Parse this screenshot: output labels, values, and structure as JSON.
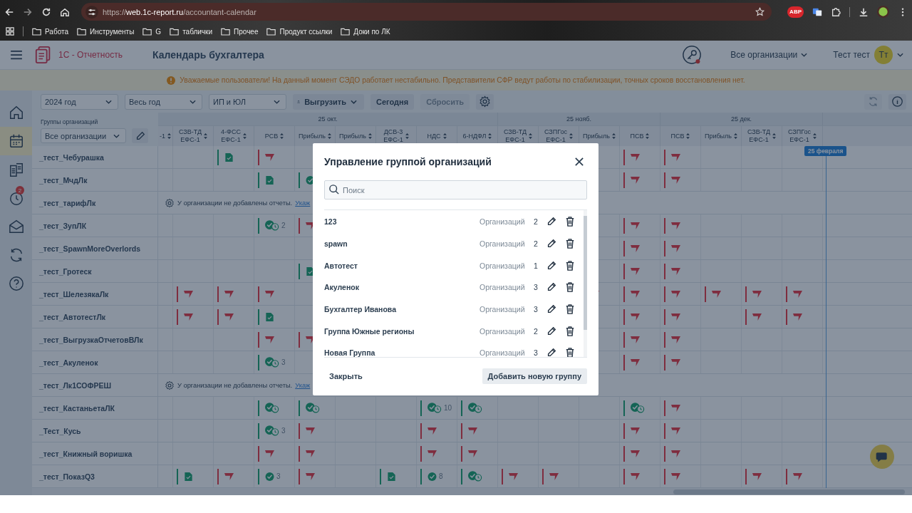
{
  "browser": {
    "url_scheme": "https://",
    "url_host": "web.1c-report.ru",
    "url_path": "/accountant-calendar",
    "extension_label": "ABP",
    "bookmarks": [
      "Работа",
      "Инструменты",
      "G",
      "таблички",
      "Прочее",
      "Продукт ссылки",
      "Доки по ЛК"
    ]
  },
  "header": {
    "app_name": "1С - Отчетность",
    "page_title": "Календарь бухгалтера",
    "key_alert": true,
    "org_select": "Все организации",
    "user_name": "Тест тест",
    "avatar": "Тт"
  },
  "banner": "Уважаемые пользователи! На данный момент СЭДО работает нестабильно. Представители СФР ведут работы по стабилизации, точных сроков восстановления нет.",
  "sidebar": [
    {
      "selected": false
    },
    {
      "selected": true
    },
    {
      "selected": false
    },
    {
      "selected": false,
      "badge": "2"
    },
    {
      "selected": false
    },
    {
      "selected": false
    },
    {
      "selected": false
    }
  ],
  "toolbar": {
    "year": "2024 год",
    "period": "Весь год",
    "entity": "ИП и ЮЛ",
    "export": "Выгрузить",
    "today": "Сегодня",
    "reset": {
      "label": "Сбросить",
      "disabled": true
    },
    "refresh_disabled": true
  },
  "groups_filter": {
    "label": "Группы организаций",
    "value": "Все организации"
  },
  "months": [
    {
      "label": "25 окт.",
      "columns": [
        {
          "lines": [
            "-1"
          ]
        },
        {
          "lines": [
            "СЗВ-ТД",
            "ЕФС-1"
          ]
        },
        {
          "lines": [
            "4-ФСС",
            "ЕФС-1"
          ]
        },
        {
          "lines": [
            "РСВ"
          ]
        },
        {
          "lines": [
            "Прибыль"
          ]
        },
        {
          "lines": [
            "Прибыль"
          ]
        },
        {
          "lines": [
            "ДСВ-3",
            "ЕФС-1"
          ]
        },
        {
          "lines": [
            "НДС"
          ]
        },
        {
          "lines": [
            "6-НДФЛ"
          ]
        }
      ]
    },
    {
      "label": "25 нояб.",
      "columns": [
        {
          "lines": [
            "СЗВ-ТД",
            "ЕФС-1"
          ]
        },
        {
          "lines": [
            "СЗПГос",
            "ЕФС-1"
          ]
        },
        {
          "lines": [
            "Прибыль"
          ]
        },
        {
          "lines": [
            "ПСВ"
          ]
        }
      ]
    },
    {
      "label": "25 дек.",
      "columns": [
        {
          "lines": [
            "ПСВ"
          ]
        },
        {
          "lines": [
            "Прибыль"
          ]
        },
        {
          "lines": [
            "СЗВ-ТД",
            "ЕФС-1"
          ]
        },
        {
          "lines": [
            "СЗПГос",
            "ЕФС-1"
          ]
        }
      ]
    }
  ],
  "today_marker": "25 февраля",
  "rows": [
    {
      "name": "_тест_Чебурашка",
      "cells": [
        {
          "kind": "empty"
        },
        {
          "kind": "empty"
        },
        {
          "kind": "document"
        },
        {
          "kind": "flag"
        },
        {
          "kind": "empty"
        },
        {
          "kind": "empty"
        },
        {
          "kind": "empty"
        },
        {
          "kind": "empty"
        },
        {
          "kind": "empty"
        },
        {
          "kind": "empty"
        },
        {
          "kind": "empty"
        },
        {
          "kind": "empty"
        },
        {
          "kind": "flag"
        },
        {
          "kind": "flag"
        },
        {
          "kind": "empty"
        },
        {
          "kind": "empty"
        },
        {
          "kind": "empty"
        }
      ]
    },
    {
      "name": "_тест_МчдЛк",
      "cells": [
        {
          "kind": "empty"
        },
        {
          "kind": "empty"
        },
        {
          "kind": "empty"
        },
        {
          "kind": "document"
        },
        {
          "kind": "check"
        },
        {
          "kind": "empty"
        },
        {
          "kind": "empty"
        },
        {
          "kind": "empty"
        },
        {
          "kind": "empty"
        },
        {
          "kind": "empty"
        },
        {
          "kind": "empty"
        },
        {
          "kind": "empty"
        },
        {
          "kind": "flag"
        },
        {
          "kind": "flag"
        },
        {
          "kind": "empty"
        },
        {
          "kind": "empty"
        },
        {
          "kind": "empty"
        }
      ]
    },
    {
      "name": "_тест_тарифЛк",
      "notice": "У организации не добавлены отчеты.",
      "link": "Укаж"
    },
    {
      "name": "_тест_ЗупЛК",
      "cells": [
        {
          "kind": "empty"
        },
        {
          "kind": "empty"
        },
        {
          "kind": "empty"
        },
        {
          "kind": "check_pending",
          "count": "2"
        },
        {
          "kind": "flag"
        },
        {
          "kind": "empty"
        },
        {
          "kind": "empty"
        },
        {
          "kind": "empty"
        },
        {
          "kind": "empty"
        },
        {
          "kind": "empty"
        },
        {
          "kind": "empty"
        },
        {
          "kind": "empty"
        },
        {
          "kind": "flag"
        },
        {
          "kind": "flag"
        },
        {
          "kind": "empty"
        },
        {
          "kind": "empty"
        },
        {
          "kind": "empty"
        }
      ]
    },
    {
      "name": "_тест_SpawnMoreOverlords",
      "cells": [
        {
          "kind": "empty"
        },
        {
          "kind": "empty"
        },
        {
          "kind": "empty"
        },
        {
          "kind": "empty"
        },
        {
          "kind": "empty"
        },
        {
          "kind": "empty"
        },
        {
          "kind": "empty"
        },
        {
          "kind": "empty"
        },
        {
          "kind": "empty"
        },
        {
          "kind": "empty"
        },
        {
          "kind": "empty"
        },
        {
          "kind": "empty"
        },
        {
          "kind": "flag"
        },
        {
          "kind": "flag"
        },
        {
          "kind": "empty"
        },
        {
          "kind": "empty"
        },
        {
          "kind": "empty"
        }
      ]
    },
    {
      "name": "_тест_Гротеск",
      "cells": [
        {
          "kind": "empty"
        },
        {
          "kind": "empty"
        },
        {
          "kind": "empty"
        },
        {
          "kind": "empty"
        },
        {
          "kind": "document"
        },
        {
          "kind": "empty"
        },
        {
          "kind": "empty"
        },
        {
          "kind": "empty"
        },
        {
          "kind": "empty"
        },
        {
          "kind": "empty"
        },
        {
          "kind": "empty"
        },
        {
          "kind": "empty"
        },
        {
          "kind": "flag"
        },
        {
          "kind": "flag"
        },
        {
          "kind": "empty"
        },
        {
          "kind": "empty"
        },
        {
          "kind": "empty"
        }
      ]
    },
    {
      "name": "_тест_ШелезякаЛк",
      "cells": [
        {
          "kind": "empty"
        },
        {
          "kind": "flag"
        },
        {
          "kind": "flag"
        },
        {
          "kind": "flag"
        },
        {
          "kind": "empty"
        },
        {
          "kind": "empty"
        },
        {
          "kind": "empty"
        },
        {
          "kind": "empty"
        },
        {
          "kind": "empty"
        },
        {
          "kind": "empty"
        },
        {
          "kind": "empty"
        },
        {
          "kind": "flag"
        },
        {
          "kind": "flag"
        },
        {
          "kind": "flag"
        },
        {
          "kind": "flag"
        },
        {
          "kind": "flag"
        },
        {
          "kind": "flag"
        }
      ]
    },
    {
      "name": "_тест_АвтотестЛк",
      "cells": [
        {
          "kind": "empty"
        },
        {
          "kind": "flag"
        },
        {
          "kind": "flag"
        },
        {
          "kind": "document"
        },
        {
          "kind": "empty"
        },
        {
          "kind": "empty"
        },
        {
          "kind": "empty"
        },
        {
          "kind": "empty"
        },
        {
          "kind": "empty"
        },
        {
          "kind": "empty"
        },
        {
          "kind": "empty"
        },
        {
          "kind": "empty"
        },
        {
          "kind": "flag"
        },
        {
          "kind": "flag"
        },
        {
          "kind": "empty"
        },
        {
          "kind": "flag"
        },
        {
          "kind": "flag"
        }
      ]
    },
    {
      "name": "_тест_ВыгрузкаОтчетовВЛк",
      "cells": [
        {
          "kind": "empty"
        },
        {
          "kind": "empty"
        },
        {
          "kind": "empty"
        },
        {
          "kind": "flag"
        },
        {
          "kind": "flag"
        },
        {
          "kind": "empty"
        },
        {
          "kind": "empty"
        },
        {
          "kind": "empty"
        },
        {
          "kind": "empty"
        },
        {
          "kind": "empty"
        },
        {
          "kind": "empty"
        },
        {
          "kind": "empty"
        },
        {
          "kind": "flag"
        },
        {
          "kind": "flag"
        },
        {
          "kind": "empty"
        },
        {
          "kind": "empty"
        },
        {
          "kind": "empty"
        }
      ]
    },
    {
      "name": "_тест_Акуленок",
      "cells": [
        {
          "kind": "empty"
        },
        {
          "kind": "empty"
        },
        {
          "kind": "empty"
        },
        {
          "kind": "check_pending",
          "count": "3"
        },
        {
          "kind": "empty"
        },
        {
          "kind": "empty"
        },
        {
          "kind": "empty"
        },
        {
          "kind": "empty"
        },
        {
          "kind": "empty"
        },
        {
          "kind": "empty"
        },
        {
          "kind": "empty"
        },
        {
          "kind": "empty"
        },
        {
          "kind": "flag"
        },
        {
          "kind": "flag"
        },
        {
          "kind": "empty"
        },
        {
          "kind": "empty"
        },
        {
          "kind": "empty"
        }
      ]
    },
    {
      "name": "_тест_Лк1СОФРЕШ",
      "notice": "У организации не добавлены отчеты.",
      "link": "Укаж"
    },
    {
      "name": "_тест_КастаньетаЛК",
      "cells": [
        {
          "kind": "empty"
        },
        {
          "kind": "empty"
        },
        {
          "kind": "empty"
        },
        {
          "kind": "check_pending"
        },
        {
          "kind": "check_pending"
        },
        {
          "kind": "empty"
        },
        {
          "kind": "empty"
        },
        {
          "kind": "check_pending",
          "count": "10"
        },
        {
          "kind": "check_pending"
        },
        {
          "kind": "empty"
        },
        {
          "kind": "empty"
        },
        {
          "kind": "empty"
        },
        {
          "kind": "check_pending"
        },
        {
          "kind": "flag"
        },
        {
          "kind": "empty"
        },
        {
          "kind": "empty"
        },
        {
          "kind": "empty"
        }
      ]
    },
    {
      "name": "_Тест_Кусь",
      "cells": [
        {
          "kind": "empty"
        },
        {
          "kind": "empty"
        },
        {
          "kind": "empty"
        },
        {
          "kind": "check_pending",
          "count": "3"
        },
        {
          "kind": "flag"
        },
        {
          "kind": "empty"
        },
        {
          "kind": "empty"
        },
        {
          "kind": "flag"
        },
        {
          "kind": "flag"
        },
        {
          "kind": "empty"
        },
        {
          "kind": "empty"
        },
        {
          "kind": "empty"
        },
        {
          "kind": "flag"
        },
        {
          "kind": "flag"
        },
        {
          "kind": "empty"
        },
        {
          "kind": "empty"
        },
        {
          "kind": "empty"
        }
      ]
    },
    {
      "name": "_тест_Книжный воришка",
      "cells": [
        {
          "kind": "empty"
        },
        {
          "kind": "empty"
        },
        {
          "kind": "empty"
        },
        {
          "kind": "flag"
        },
        {
          "kind": "flag"
        },
        {
          "kind": "empty"
        },
        {
          "kind": "empty"
        },
        {
          "kind": "flag"
        },
        {
          "kind": "flag"
        },
        {
          "kind": "empty"
        },
        {
          "kind": "empty"
        },
        {
          "kind": "empty"
        },
        {
          "kind": "flag"
        },
        {
          "kind": "flag"
        },
        {
          "kind": "empty"
        },
        {
          "kind": "empty"
        },
        {
          "kind": "empty"
        }
      ]
    },
    {
      "name": "_тест_ПоказQ3",
      "cells": [
        {
          "kind": "empty"
        },
        {
          "kind": "document"
        },
        {
          "kind": "flag"
        },
        {
          "kind": "check",
          "count": "3"
        },
        {
          "kind": "flag"
        },
        {
          "kind": "empty"
        },
        {
          "kind": "document"
        },
        {
          "kind": "check",
          "count": "8"
        },
        {
          "kind": "check_pending"
        },
        {
          "kind": "flag"
        },
        {
          "kind": "flag"
        },
        {
          "kind": "empty"
        },
        {
          "kind": "flag"
        },
        {
          "kind": "flag"
        },
        {
          "kind": "empty"
        },
        {
          "kind": "flag"
        },
        {
          "kind": "flag"
        }
      ]
    }
  ],
  "modal": {
    "title": "Управление группой организаций",
    "search_placeholder": "Поиск",
    "groups": [
      {
        "name": "123",
        "count_label": "Организаций",
        "count": "2"
      },
      {
        "name": "spawn",
        "count_label": "Организаций",
        "count": "2"
      },
      {
        "name": "Автотест",
        "count_label": "Организаций",
        "count": "1"
      },
      {
        "name": "Акуленок",
        "count_label": "Организаций",
        "count": "3"
      },
      {
        "name": "Бухгалтер Иванова",
        "count_label": "Организаций",
        "count": "3"
      },
      {
        "name": "Группа Южные регионы",
        "count_label": "Организаций",
        "count": "2"
      },
      {
        "name": "Новая Группа",
        "count_label": "Организаций",
        "count": "3"
      }
    ],
    "close": "Закрыть",
    "add": "Добавить новую группу"
  }
}
